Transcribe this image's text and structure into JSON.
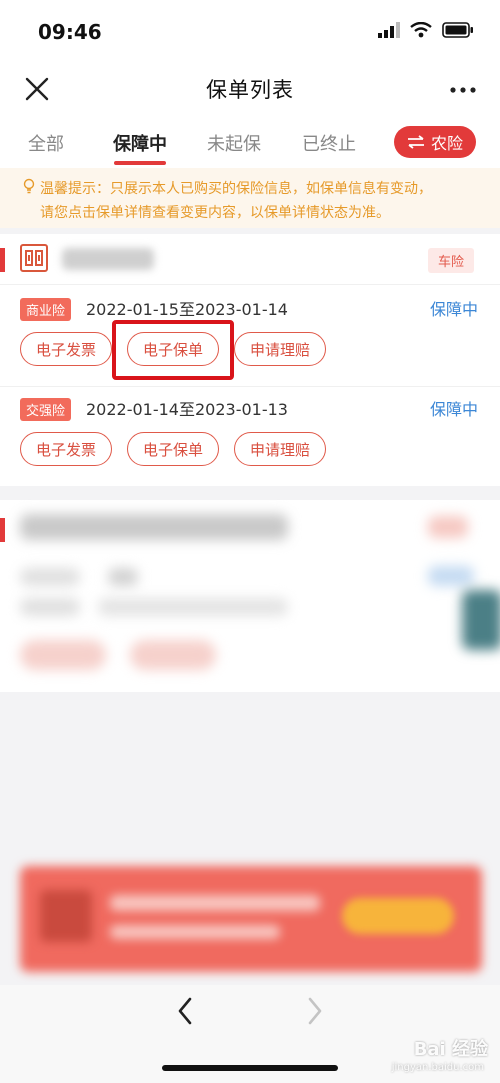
{
  "status_bar": {
    "time": "09:46"
  },
  "navbar": {
    "title": "保单列表"
  },
  "tabs": [
    {
      "label": "全部"
    },
    {
      "label": "保障中"
    },
    {
      "label": "未起保"
    },
    {
      "label": "已终止"
    }
  ],
  "active_tab": "保障中",
  "switch_button": {
    "label": "农险"
  },
  "tip": {
    "line1": "温馨提示：只展示本人已购买的保险信息，如保单信息有变动，",
    "line2": "请您点击保单详情查看变更内容，以保单详情状态为准。"
  },
  "card": {
    "type_badge": "车险",
    "policies": [
      {
        "badge": "商业险",
        "date_range": "2022-01-15至2023-01-14",
        "status": "保障中",
        "buttons": [
          "电子发票",
          "电子保单",
          "申请理赔"
        ]
      },
      {
        "badge": "交强险",
        "date_range": "2022-01-14至2023-01-13",
        "status": "保障中",
        "buttons": [
          "电子发票",
          "电子保单",
          "申请理赔"
        ]
      }
    ]
  },
  "watermark": {
    "text": "Bai 经验",
    "sub": "jingyan.baidu.com"
  },
  "colors": {
    "accent": "#e23a3a",
    "status_blue": "#3c87d6",
    "tip_text": "#e69a2a",
    "highlight": "#d9141a"
  }
}
